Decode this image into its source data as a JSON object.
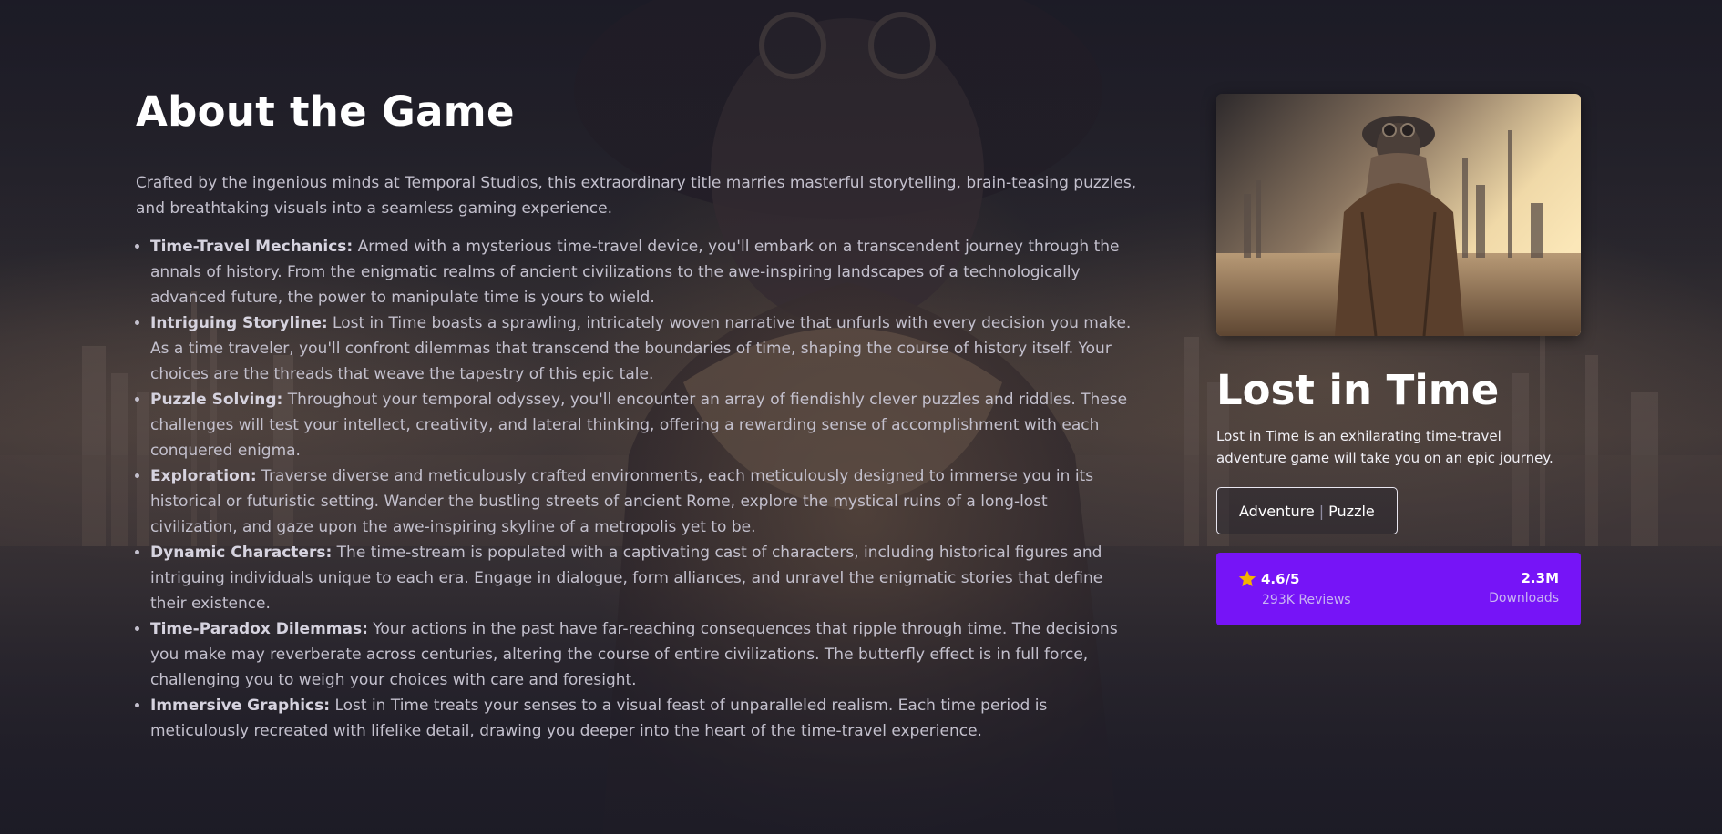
{
  "about": {
    "title": "About the Game",
    "intro": "Crafted by the ingenious minds at Temporal Studios, this extraordinary title marries masterful storytelling, brain-teasing puzzles, and breathtaking visuals into a seamless gaming experience.",
    "features": [
      {
        "name": "Time-Travel Mechanics:",
        "text": " Armed with a mysterious time-travel device, you'll embark on a transcendent journey through the annals of history. From the enigmatic realms of ancient civilizations to the awe-inspiring landscapes of a technologically advanced future, the power to manipulate time is yours to wield."
      },
      {
        "name": "Intriguing Storyline:",
        "text": " Lost in Time boasts a sprawling, intricately woven narrative that unfurls with every decision you make. As a time traveler, you'll confront dilemmas that transcend the boundaries of time, shaping the course of history itself. Your choices are the threads that weave the tapestry of this epic tale."
      },
      {
        "name": "Puzzle Solving:",
        "text": " Throughout your temporal odyssey, you'll encounter an array of fiendishly clever puzzles and riddles. These challenges will test your intellect, creativity, and lateral thinking, offering a rewarding sense of accomplishment with each conquered enigma."
      },
      {
        "name": "Exploration:",
        "text": " Traverse diverse and meticulously crafted environments, each meticulously designed to immerse you in its historical or futuristic setting. Wander the bustling streets of ancient Rome, explore the mystical ruins of a long-lost civilization, and gaze upon the awe-inspiring skyline of a metropolis yet to be."
      },
      {
        "name": "Dynamic Characters:",
        "text": " The time-stream is populated with a captivating cast of characters, including historical figures and intriguing individuals unique to each era. Engage in dialogue, form alliances, and unravel the enigmatic stories that define their existence."
      },
      {
        "name": "Time-Paradox Dilemmas:",
        "text": " Your actions in the past have far-reaching consequences that ripple through time. The decisions you make may reverberate across centuries, altering the course of entire civilizations. The butterfly effect is in full force, challenging you to weigh your choices with care and foresight."
      },
      {
        "name": "Immersive Graphics:",
        "text": " Lost in Time treats your senses to a visual feast of unparalleled realism. Each time period is meticulously recreated with lifelike detail, drawing you deeper into the heart of the time-travel experience."
      }
    ]
  },
  "game": {
    "title": "Lost in Time",
    "description": "Lost in Time is an exhilarating time-travel adventure game will take you on an epic journey.",
    "genres": [
      "Adventure",
      "Puzzle"
    ],
    "genre_separator": "|",
    "rating": {
      "value": "4.6/5",
      "label": "293K Reviews",
      "icon": "star-icon"
    },
    "downloads": {
      "value": "2.3M",
      "label": "Downloads"
    }
  },
  "colors": {
    "accent": "#7614f7",
    "star": "#f5b301",
    "background": "#1e1c27"
  }
}
